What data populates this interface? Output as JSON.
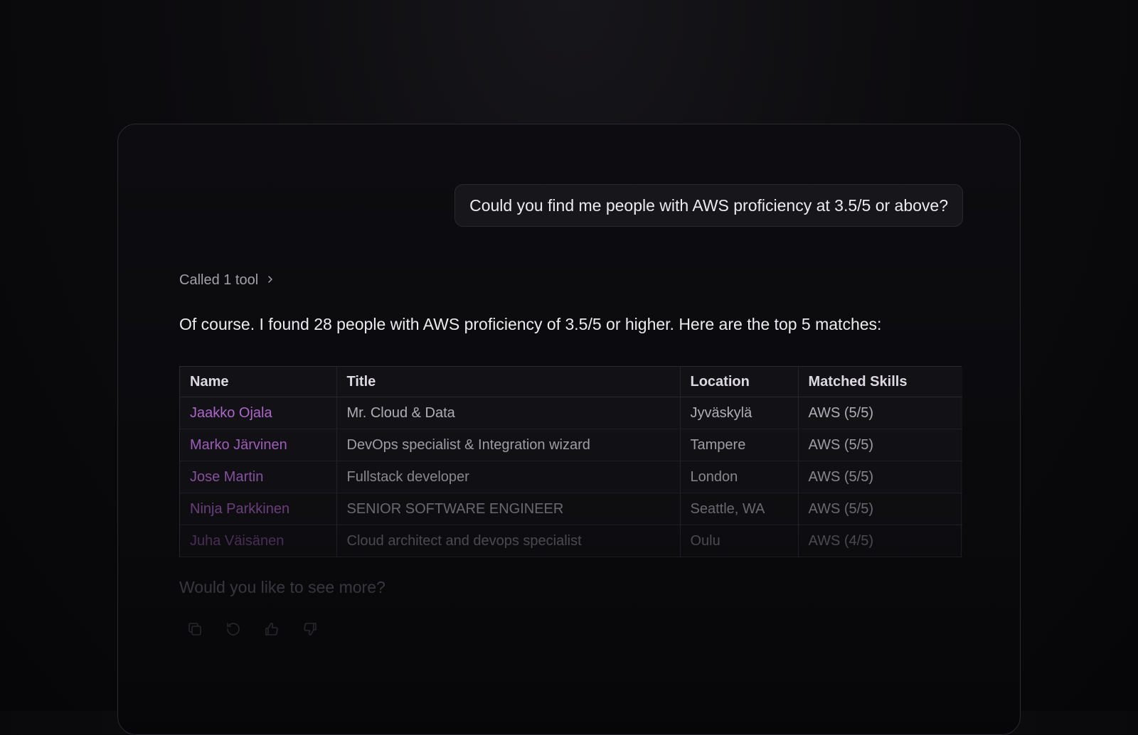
{
  "chat": {
    "user_message": "Could you find me people with AWS proficiency at 3.5/5 or above?",
    "tool_call_label": "Called 1 tool",
    "assistant_message": "Of course. I found 28 people with AWS proficiency of 3.5/5 or higher. Here are the top 5 matches:",
    "followup": "Would you like to see more?"
  },
  "table": {
    "headers": [
      "Name",
      "Title",
      "Location",
      "Matched Skills"
    ],
    "rows": [
      {
        "name": "Jaakko Ojala",
        "title": "Mr. Cloud & Data",
        "location": "Jyväskylä",
        "skills": "AWS (5/5)"
      },
      {
        "name": "Marko Järvinen",
        "title": "DevOps specialist & Integration wizard",
        "location": "Tampere",
        "skills": "AWS (5/5)"
      },
      {
        "name": "Jose Martin",
        "title": "Fullstack developer",
        "location": "London",
        "skills": "AWS (5/5)"
      },
      {
        "name": "Ninja Parkkinen",
        "title": "SENIOR SOFTWARE ENGINEER",
        "location": "Seattle, WA",
        "skills": "AWS (5/5)"
      },
      {
        "name": "Juha Väisänen",
        "title": "Cloud architect and devops specialist",
        "location": "Oulu",
        "skills": "AWS (4/5)"
      }
    ]
  },
  "actions": {
    "icons": [
      "copy-icon",
      "regenerate-icon",
      "thumbs-up-icon",
      "thumbs-down-icon"
    ]
  },
  "colors": {
    "name_link": "#b56cd4",
    "background": "#08080a"
  }
}
